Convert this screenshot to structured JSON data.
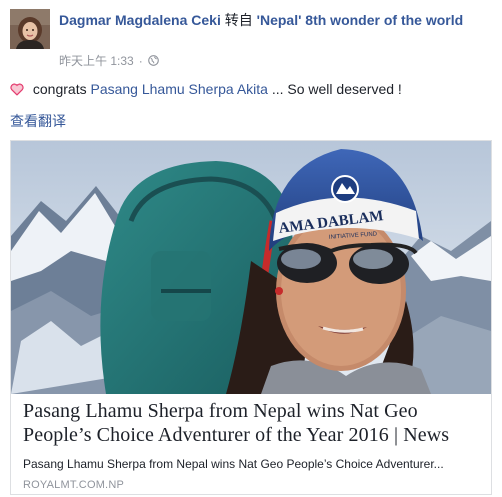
{
  "post": {
    "author_name": "Dagmar Magdalena Ceki",
    "share_word": "转自",
    "group_name": "'Nepal' 8th wonder of the world",
    "timestamp": "昨天上午 1:33",
    "separator": "·",
    "privacy_icon": "globe-icon",
    "avatar_icon": "profile-photo",
    "message": {
      "icon": "heart-icon",
      "prefix": " congrats ",
      "mention": "Pasang Lhamu Sherpa Akita",
      "suffix": " ... So well deserved !"
    },
    "translate_link": "查看翻译"
  },
  "link_card": {
    "image": "woman-climber-selfie-with-backpack-in-front-of-snowy-mountains",
    "cap_text": "AMA DABLAM",
    "cap_subtext": "INITIATIVE FUND",
    "title": "Pasang Lhamu Sherpa from Nepal wins Nat Geo People’s Choice Adventurer of the Year 2016 | News",
    "description": "Pasang Lhamu Sherpa from Nepal wins Nat Geo People’s Choice Adventurer...",
    "domain": "ROYALMT.COM.NP"
  },
  "colors": {
    "link": "#365899",
    "text": "#1d2129",
    "meta": "#90949c",
    "border": "#dddfe2",
    "heart": "#e0245e"
  }
}
